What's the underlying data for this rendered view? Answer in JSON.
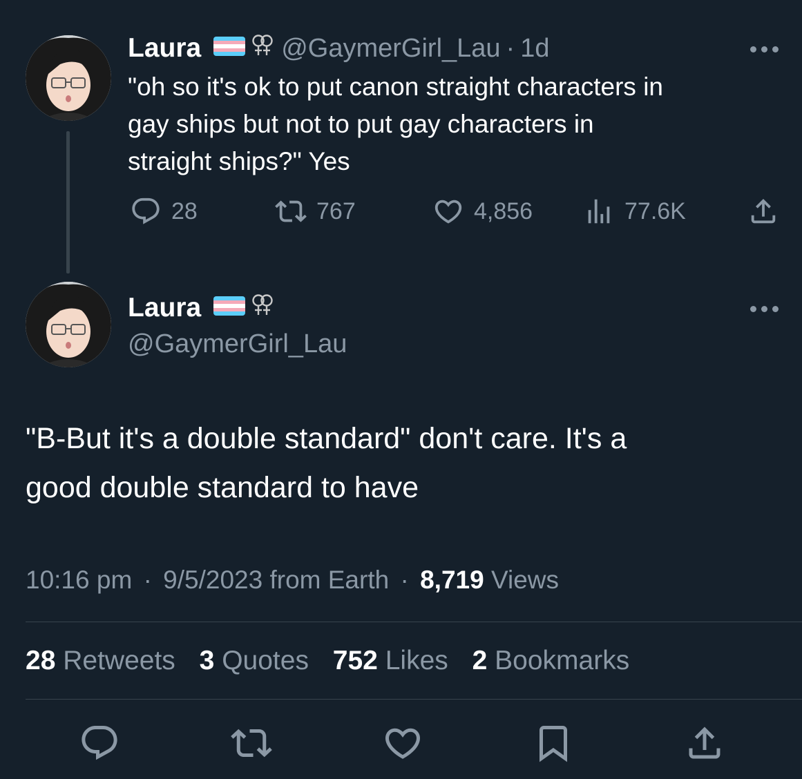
{
  "quoted_tweet": {
    "author_name": "Laura",
    "handle": "@GaymerGirl_Lau",
    "separator": "·",
    "time_ago": "1d",
    "text_lines": [
      "\"oh so it's ok to put canon straight characters in",
      "gay ships but not to put gay characters in",
      "straight ships?\" Yes"
    ],
    "metrics": {
      "replies": "28",
      "retweets": "767",
      "likes": "4,856",
      "views": "77.6K"
    }
  },
  "main_tweet": {
    "author_name": "Laura",
    "handle": "@GaymerGirl_Lau",
    "text_lines": [
      "\"B-But it's a double standard\" don't care. It's a",
      "good double standard to have"
    ],
    "time": "10:16 pm",
    "separator": "·",
    "date_source": "9/5/2023 from Earth",
    "views_count": "8,719",
    "views_label": "Views"
  },
  "stats": {
    "retweets_count": "28",
    "retweets_label": "Retweets",
    "quotes_count": "3",
    "quotes_label": "Quotes",
    "likes_count": "752",
    "likes_label": "Likes",
    "bookmarks_count": "2",
    "bookmarks_label": "Bookmarks"
  },
  "icons": {
    "flag": "trans-flag-icon",
    "symbol": "lesbian-symbol-icon",
    "reply": "reply-icon",
    "retweet": "retweet-icon",
    "like": "heart-icon",
    "views": "views-icon",
    "share": "share-icon",
    "bookmark": "bookmark-icon",
    "more": "more-icon"
  },
  "colors": {
    "background": "#15202b",
    "text": "#ffffff",
    "muted": "#8b98a5",
    "divider": "#38444d",
    "flag_blue": "#5bcefa",
    "flag_pink": "#f5a9b8",
    "flag_white": "#ffffff"
  }
}
